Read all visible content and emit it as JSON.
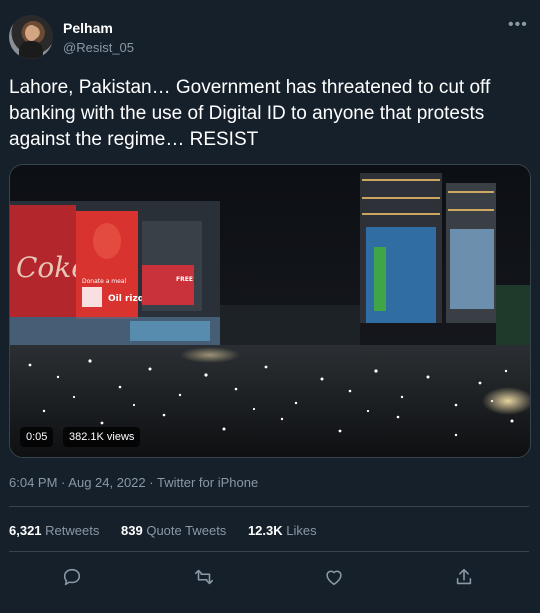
{
  "author": {
    "name": "Pelham",
    "handle": "@Resist_05"
  },
  "tweet": {
    "text": "Lahore, Pakistan… Government has threatened to cut off banking with the use of Digital ID to anyone that protests against the regime… RESIST"
  },
  "media": {
    "duration": "0:05",
    "views": "382.1K views",
    "billboard_texts": [
      "Coke",
      "Donate a meal",
      "Oil rizq",
      "FREE"
    ]
  },
  "meta": {
    "time": "6:04 PM",
    "separator": "·",
    "date": "Aug 24, 2022",
    "source": "Twitter for iPhone"
  },
  "stats": {
    "retweets_num": "6,321",
    "retweets_label": "Retweets",
    "quotes_num": "839",
    "quotes_label": "Quote Tweets",
    "likes_num": "12.3K",
    "likes_label": "Likes"
  },
  "icons": {
    "more": "more-horizontal-icon",
    "reply": "reply-icon",
    "retweet": "retweet-icon",
    "like": "heart-icon",
    "share": "share-icon"
  },
  "colors": {
    "background": "#15202b",
    "secondary_text": "#8b98a5",
    "border": "#38444d"
  }
}
